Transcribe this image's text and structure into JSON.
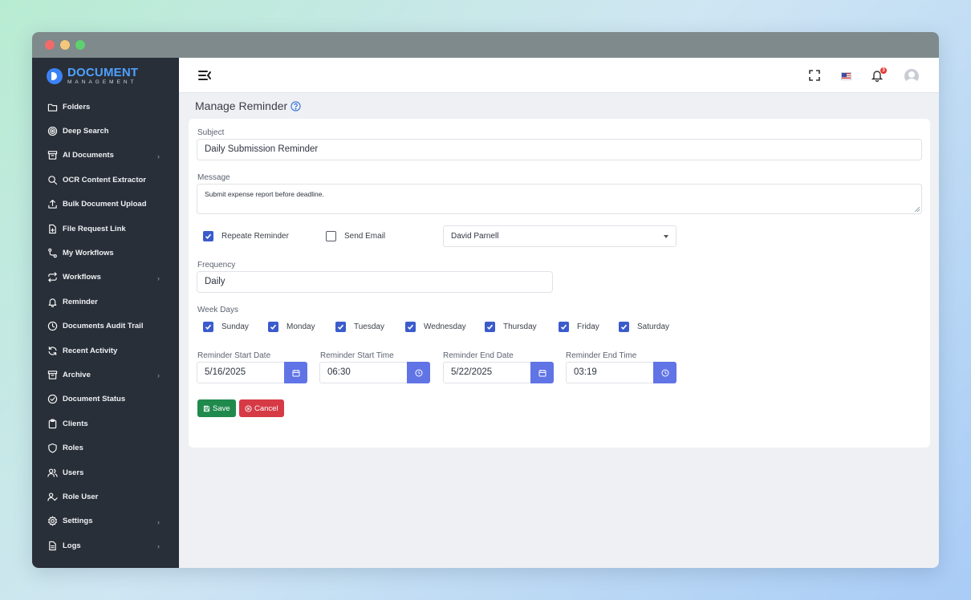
{
  "brand": {
    "name": "DOCUMENT",
    "tagline": "MANAGEMENT"
  },
  "sidebar": {
    "items": [
      {
        "label": "Folders",
        "icon": "folder-icon",
        "has_submenu": false
      },
      {
        "label": "Deep Search",
        "icon": "target-icon",
        "has_submenu": false
      },
      {
        "label": "AI Documents",
        "icon": "archive-box-icon",
        "has_submenu": true
      },
      {
        "label": "OCR Content Extractor",
        "icon": "search-icon",
        "has_submenu": false
      },
      {
        "label": "Bulk Document Upload",
        "icon": "upload-icon",
        "has_submenu": false
      },
      {
        "label": "File Request Link",
        "icon": "file-plus-icon",
        "has_submenu": false
      },
      {
        "label": "My Workflows",
        "icon": "route-icon",
        "has_submenu": false
      },
      {
        "label": "Workflows",
        "icon": "repeat-icon",
        "has_submenu": true
      },
      {
        "label": "Reminder",
        "icon": "bell-icon",
        "has_submenu": false
      },
      {
        "label": "Documents Audit Trail",
        "icon": "clock-icon",
        "has_submenu": false
      },
      {
        "label": "Recent Activity",
        "icon": "refresh-icon",
        "has_submenu": false
      },
      {
        "label": "Archive",
        "icon": "archive-box-icon",
        "has_submenu": true
      },
      {
        "label": "Document Status",
        "icon": "check-circle-icon",
        "has_submenu": false
      },
      {
        "label": "Clients",
        "icon": "clipboard-icon",
        "has_submenu": false
      },
      {
        "label": "Roles",
        "icon": "shield-icon",
        "has_submenu": false
      },
      {
        "label": "Users",
        "icon": "users-icon",
        "has_submenu": false
      },
      {
        "label": "Role User",
        "icon": "user-check-icon",
        "has_submenu": false
      },
      {
        "label": "Settings",
        "icon": "gear-icon",
        "has_submenu": true
      },
      {
        "label": "Logs",
        "icon": "document-icon",
        "has_submenu": true
      }
    ],
    "chevron": "›"
  },
  "header": {
    "notification_count": "3"
  },
  "page": {
    "title": "Manage Reminder"
  },
  "form": {
    "subject": {
      "label": "Subject",
      "value": "Daily Submission Reminder"
    },
    "message": {
      "label": "Message",
      "value": "Submit expense report before deadline."
    },
    "repeat_reminder": {
      "label": "Repeate Reminder",
      "checked": true
    },
    "send_email": {
      "label": "Send Email",
      "checked": false
    },
    "user_select": {
      "value": "David Parnell"
    },
    "frequency": {
      "label": "Frequency",
      "value": "Daily"
    },
    "week_days": {
      "label": "Week Days",
      "days": [
        {
          "label": "Sunday",
          "checked": true
        },
        {
          "label": "Monday",
          "checked": true
        },
        {
          "label": "Tuesday",
          "checked": true
        },
        {
          "label": "Wednesday",
          "checked": true
        },
        {
          "label": "Thursday",
          "checked": true
        },
        {
          "label": "Friday",
          "checked": true
        },
        {
          "label": "Saturday",
          "checked": true
        }
      ]
    },
    "start_date": {
      "label": "Reminder Start Date",
      "value": "5/16/2025"
    },
    "start_time": {
      "label": "Reminder Start Time",
      "value": "06:30"
    },
    "end_date": {
      "label": "Reminder End Date",
      "value": "5/22/2025"
    },
    "end_time": {
      "label": "Reminder End Time",
      "value": "03:19"
    },
    "save_label": "Save",
    "cancel_label": "Cancel"
  },
  "colors": {
    "sidebar_bg": "#292f38",
    "accent": "#3b5bcd",
    "picker_button": "#6074e6",
    "save": "#1f8a4c",
    "cancel": "#d63a45",
    "brand": "#4ea1ff"
  }
}
